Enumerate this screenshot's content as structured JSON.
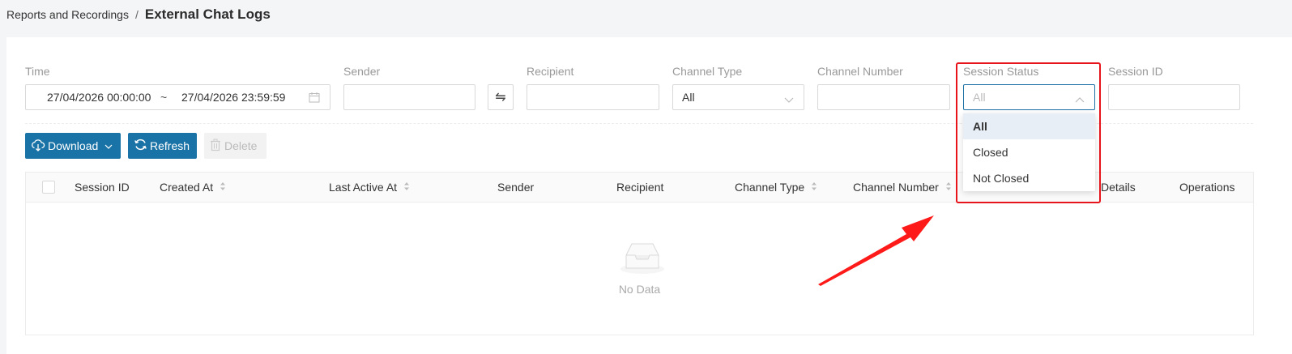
{
  "breadcrumb": {
    "parent": "Reports and Recordings",
    "separator": "/",
    "current": "External Chat Logs"
  },
  "filters": {
    "time": {
      "label": "Time",
      "start": "27/04/2026 00:00:00",
      "tilde": "~",
      "end": "27/04/2026 23:59:59",
      "icon": "calendar-icon"
    },
    "sender": {
      "label": "Sender",
      "value": ""
    },
    "swap": {
      "icon": "swap-icon",
      "glyph": "⇋"
    },
    "recipient": {
      "label": "Recipient",
      "value": ""
    },
    "channel_type": {
      "label": "Channel Type",
      "value": "All"
    },
    "channel_number": {
      "label": "Channel Number",
      "value": ""
    },
    "session_status": {
      "label": "Session Status",
      "placeholder": "All",
      "open": true
    },
    "session_id": {
      "label": "Session ID",
      "value": ""
    }
  },
  "toolbar": {
    "download_label": "Download",
    "refresh_label": "Refresh",
    "delete_label": "Delete"
  },
  "table": {
    "columns": [
      {
        "label": "Session ID",
        "sortable": false
      },
      {
        "label": "Created At",
        "sortable": true
      },
      {
        "label": "Last Active At",
        "sortable": true
      },
      {
        "label": "Sender",
        "sortable": false
      },
      {
        "label": "Recipient",
        "sortable": false
      },
      {
        "label": "Channel Type",
        "sortable": true
      },
      {
        "label": "Channel Number",
        "sortable": true
      },
      {
        "label": "Details",
        "sortable": false
      },
      {
        "label": "Operations",
        "sortable": false
      }
    ],
    "empty_text": "No Data"
  },
  "session_status_dropdown": {
    "options": [
      "All",
      "Closed",
      "Not Closed"
    ],
    "selected": "All"
  },
  "annotation": {
    "highlight_color": "#e8141b"
  },
  "colors": {
    "primary": "#1a73a6",
    "highlight": "#e8141b"
  }
}
